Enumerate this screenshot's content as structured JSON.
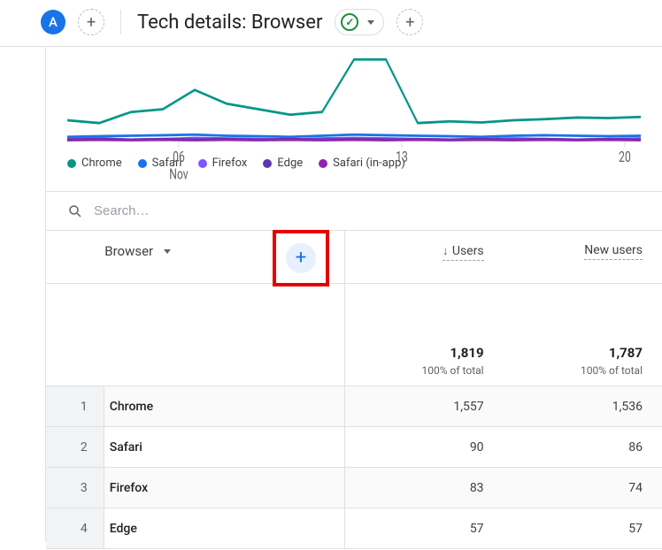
{
  "header": {
    "avatar_letter": "A",
    "title": "Tech details: Browser"
  },
  "chart_data": {
    "type": "line",
    "x_ticks": [
      "06",
      "13",
      "20"
    ],
    "x_tick_sub": "Nov",
    "series": [
      {
        "name": "Chrome",
        "color": "#009688",
        "values": [
          40,
          35,
          55,
          60,
          95,
          70,
          60,
          50,
          55,
          150,
          150,
          35,
          38,
          36,
          40,
          42,
          45,
          44,
          46
        ]
      },
      {
        "name": "Safari",
        "color": "#1a73e8",
        "values": [
          10,
          11,
          12,
          13,
          14,
          12,
          11,
          10,
          12,
          14,
          13,
          12,
          11,
          10,
          12,
          13,
          12,
          11,
          12
        ]
      },
      {
        "name": "Firefox",
        "color": "#7b57ff",
        "values": [
          6,
          7,
          5,
          6,
          8,
          7,
          6,
          5,
          7,
          8,
          7,
          6,
          5,
          6,
          7,
          6,
          5,
          6,
          7
        ]
      },
      {
        "name": "Edge",
        "color": "#5e35b1",
        "values": [
          5,
          6,
          5,
          6,
          5,
          6,
          5,
          6,
          5,
          6,
          5,
          6,
          5,
          6,
          5,
          6,
          5,
          6,
          5
        ]
      },
      {
        "name": "Safari (in-app)",
        "color": "#8e24aa",
        "values": [
          4,
          5,
          4,
          5,
          4,
          5,
          4,
          5,
          4,
          5,
          4,
          5,
          4,
          5,
          4,
          5,
          4,
          5,
          4
        ]
      }
    ],
    "ymax": 160
  },
  "search": {
    "placeholder": "Search…"
  },
  "dimension": {
    "label": "Browser"
  },
  "metrics": [
    {
      "label": "Users",
      "sorted": true,
      "total": "1,819",
      "total_sub": "100% of total"
    },
    {
      "label": "New users",
      "sorted": false,
      "total": "1,787",
      "total_sub": "100% of total"
    }
  ],
  "rows": [
    {
      "idx": "1",
      "dim": "Chrome",
      "m": [
        "1,557",
        "1,536"
      ]
    },
    {
      "idx": "2",
      "dim": "Safari",
      "m": [
        "90",
        "86"
      ]
    },
    {
      "idx": "3",
      "dim": "Firefox",
      "m": [
        "83",
        "74"
      ]
    },
    {
      "idx": "4",
      "dim": "Edge",
      "m": [
        "57",
        "57"
      ]
    }
  ]
}
